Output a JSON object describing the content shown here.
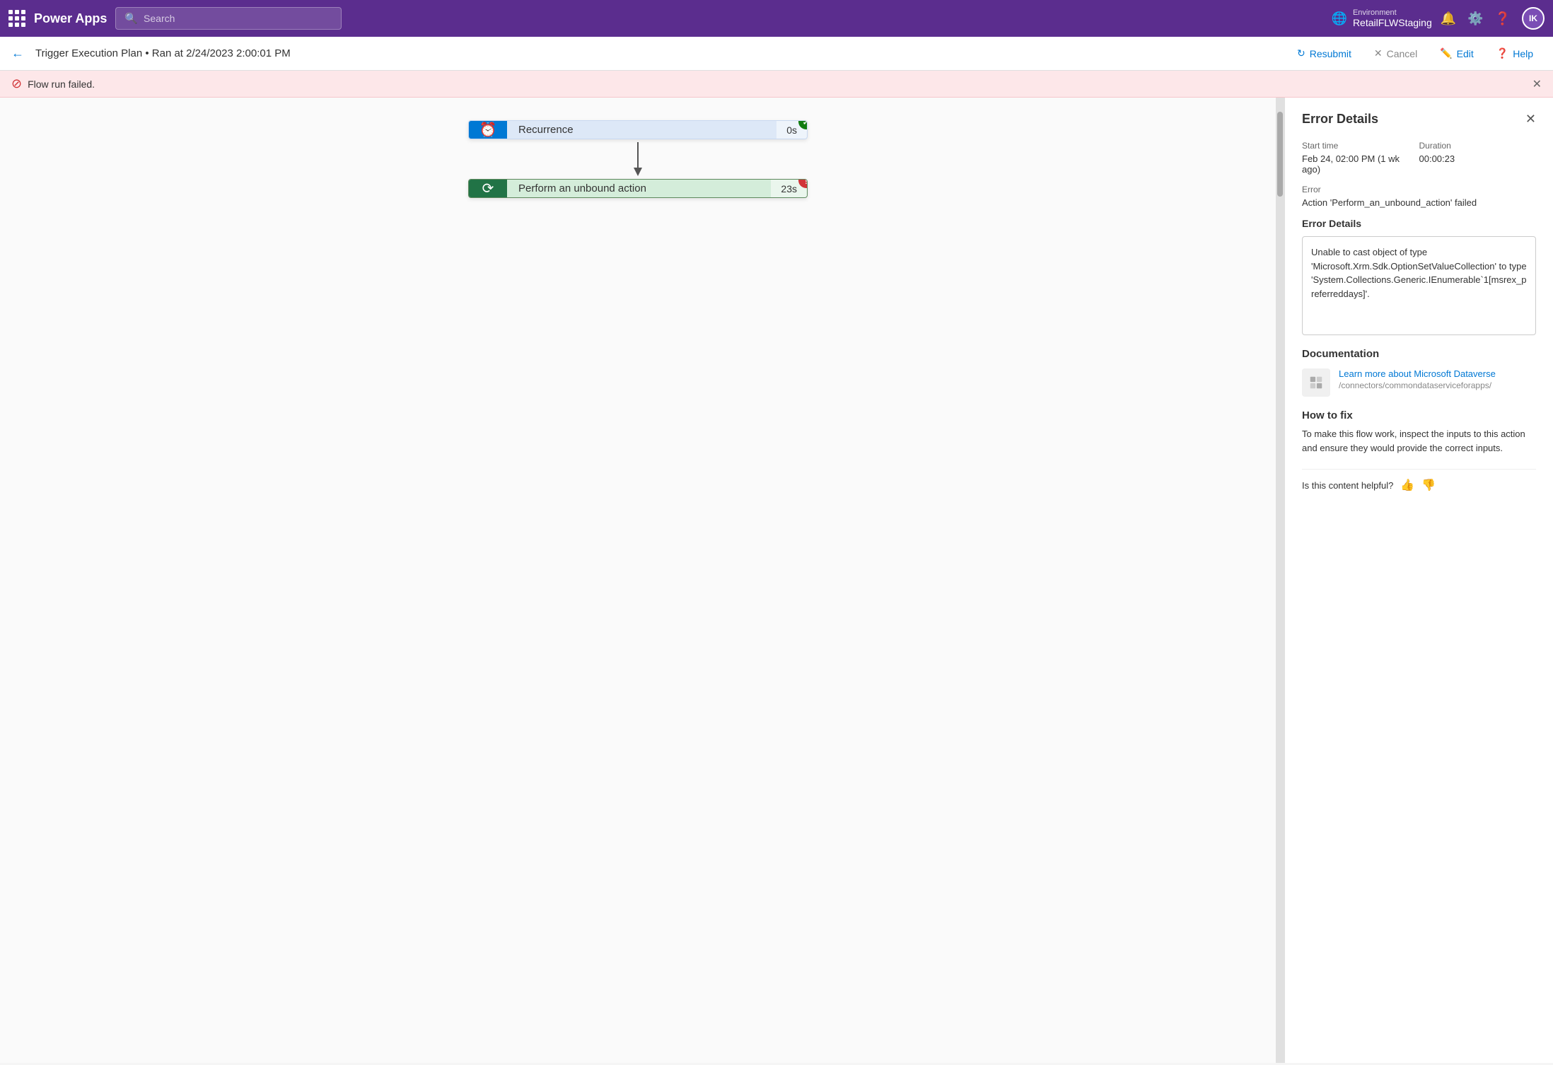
{
  "topNav": {
    "appName": "Power Apps",
    "searchPlaceholder": "Search",
    "environment": {
      "label": "Environment",
      "name": "RetailFLWStaging"
    },
    "avatarInitials": "IK"
  },
  "subNav": {
    "title": "Trigger Execution Plan • Ran at 2/24/2023 2:00:01 PM",
    "resubmit": "Resubmit",
    "cancel": "Cancel",
    "edit": "Edit",
    "help": "Help"
  },
  "errorBanner": {
    "message": "Flow run failed."
  },
  "flowNodes": [
    {
      "id": "recurrence",
      "label": "Recurrence",
      "duration": "0s",
      "status": "success",
      "iconType": "clock"
    },
    {
      "id": "unbound",
      "label": "Perform an unbound action",
      "duration": "23s",
      "status": "error",
      "iconType": "dataverse"
    }
  ],
  "errorPanel": {
    "title": "Error Details",
    "startTimeLabel": "Start time",
    "startTimeValue": "Feb 24, 02:00 PM (1 wk ago)",
    "durationLabel": "Duration",
    "durationValue": "00:00:23",
    "errorLabel": "Error",
    "errorValue": "Action 'Perform_an_unbound_action' failed",
    "errorDetailsHeading": "Error Details",
    "errorDetailsText": "Unable to cast object of type 'Microsoft.Xrm.Sdk.OptionSetValueCollection' to type 'System.Collections.Generic.IEnumerable`1[msrex_preferreddays]'.",
    "documentationHeading": "Documentation",
    "docLinkText": "Learn more about Microsoft Dataverse",
    "docLinkUrl": "/connectors/commondataserviceforapps/",
    "howToFixHeading": "How to fix",
    "howToFixText": "To make this flow work, inspect the inputs to this action and ensure they would provide the correct inputs.",
    "isHelpfulLabel": "Is this content helpful?"
  }
}
